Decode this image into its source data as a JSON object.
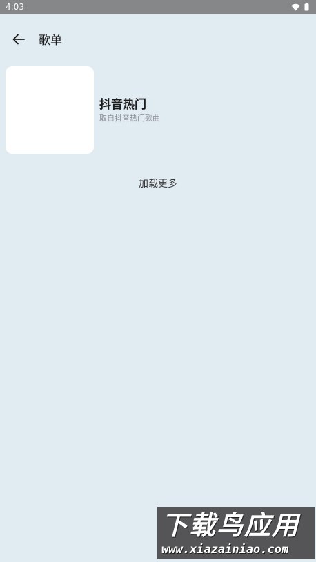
{
  "status_bar": {
    "time": "4:03",
    "icons": [
      "wifi-icon",
      "battery-icon"
    ]
  },
  "header": {
    "back_icon": "arrow-left-icon",
    "title": "歌单"
  },
  "playlists": [
    {
      "title": "抖音热门",
      "description": "取自抖音热门歌曲"
    }
  ],
  "load_more_label": "加载更多",
  "watermark": {
    "name": "下载鸟应用",
    "url": "www.xiazainiao.com"
  },
  "colors": {
    "background": "#e1ebf2",
    "status_bar": "#868788",
    "cover": "#ffffff",
    "description_text": "#8a8f94"
  }
}
